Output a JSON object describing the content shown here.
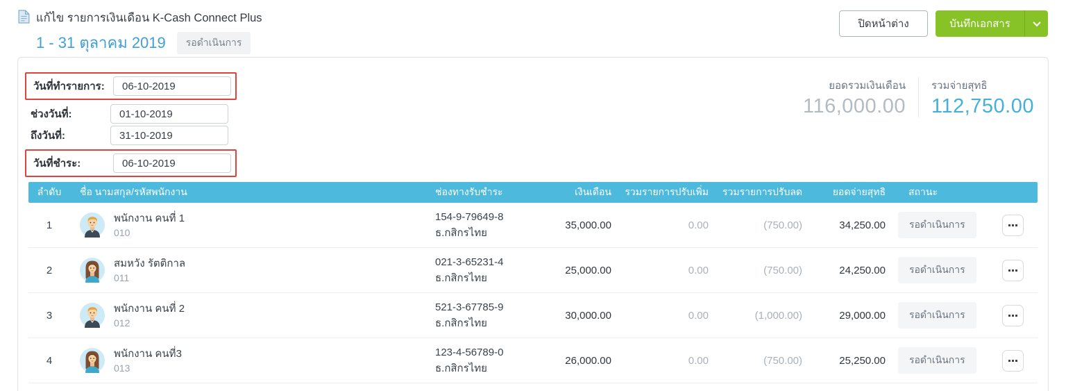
{
  "header": {
    "title": "แก้ไข รายการเงินเดือน K-Cash Connect Plus",
    "period": "1 - 31 ตุลาคม 2019",
    "status_badge": "รอดำเนินการ",
    "close_button": "ปิดหน้าต่าง",
    "save_button": "บันทึกเอกสาร"
  },
  "form": {
    "transaction_date": {
      "label": "วันที่ทำรายการ:",
      "value": "06-10-2019"
    },
    "range_start": {
      "label": "ช่วงวันที่:",
      "value": "01-10-2019"
    },
    "range_end": {
      "label": "ถึงวันที่:",
      "value": "31-10-2019"
    },
    "payment_date": {
      "label": "วันที่ชำระ:",
      "value": "06-10-2019"
    }
  },
  "summary": {
    "total_salary": {
      "label": "ยอดรวมเงินเดือน",
      "value": "116,000.00"
    },
    "total_net": {
      "label": "รวมจ่ายสุทธิ",
      "value": "112,750.00"
    }
  },
  "table": {
    "columns": [
      "ลำดับ",
      "ชื่อ นามสกุล/รหัสพนักงาน",
      "ช่องทางรับชำระ",
      "เงินเดือน",
      "รวมรายการปรับเพิ่ม",
      "รวมรายการปรับลด",
      "ยอดจ่ายสุทธิ",
      "สถานะ"
    ],
    "rows": [
      {
        "no": "1",
        "avatar": "male",
        "name": "พนักงาน คนที่ 1",
        "code": "010",
        "account": "154-9-79649-8",
        "bank": "ธ.กสิกรไทย",
        "salary": "35,000.00",
        "additions": "0.00",
        "deductions": "(750.00)",
        "net": "34,250.00",
        "status": "รอดำเนินการ"
      },
      {
        "no": "2",
        "avatar": "female",
        "name": "สมหวัง รัตติกาล",
        "code": "011",
        "account": "021-3-65231-4",
        "bank": "ธ.กสิกรไทย",
        "salary": "25,000.00",
        "additions": "0.00",
        "deductions": "(750.00)",
        "net": "24,250.00",
        "status": "รอดำเนินการ"
      },
      {
        "no": "3",
        "avatar": "male",
        "name": "พนักงาน คนที่ 2",
        "code": "012",
        "account": "521-3-67785-9",
        "bank": "ธ.กสิกรไทย",
        "salary": "30,000.00",
        "additions": "0.00",
        "deductions": "(1,000.00)",
        "net": "29,000.00",
        "status": "รอดำเนินการ"
      },
      {
        "no": "4",
        "avatar": "female",
        "name": "พนักงาน คนที่3",
        "code": "013",
        "account": "123-4-56789-0",
        "bank": "ธ.กสิกรไทย",
        "salary": "26,000.00",
        "additions": "0.00",
        "deductions": "(750.00)",
        "net": "25,250.00",
        "status": "รอดำเนินการ"
      }
    ]
  },
  "colors": {
    "accent_blue": "#3f9fd8",
    "table_header_blue": "#4cb9dd",
    "save_green": "#87c227",
    "highlight_red": "#e0433b",
    "net_total_blue": "#44b0da",
    "gray_total": "#b3bbc2",
    "muted_amount": "#a9b1b9"
  }
}
